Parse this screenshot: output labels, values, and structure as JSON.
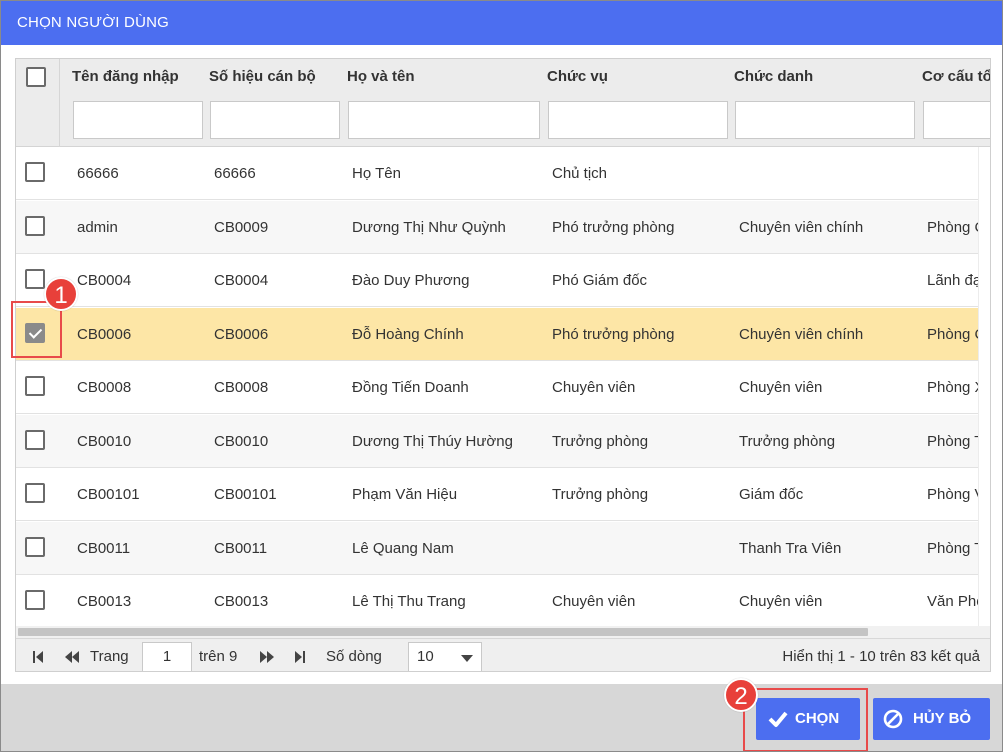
{
  "dialog": {
    "title": "CHỌN NGƯỜI DÙNG"
  },
  "columns": [
    "Tên đăng nhập",
    "Số hiệu cán bộ",
    "Họ và tên",
    "Chức vụ",
    "Chức danh",
    "Cơ cấu tổ"
  ],
  "rows": [
    {
      "username": "66666",
      "code": "66666",
      "fullname": "Họ Tên",
      "position": "Chủ tịch",
      "title": "",
      "org": "",
      "checked": false
    },
    {
      "username": "admin",
      "code": "CB0009",
      "fullname": "Dương Thị Như Quỳnh",
      "position": "Phó trưởng phòng",
      "title": "Chuyên viên chính",
      "org": "Phòng C",
      "checked": false
    },
    {
      "username": "CB0004",
      "code": "CB0004",
      "fullname": "Đào Duy Phương",
      "position": "Phó Giám đốc",
      "title": "",
      "org": "Lãnh đạ",
      "checked": false
    },
    {
      "username": "CB0006",
      "code": "CB0006",
      "fullname": "Đỗ Hoàng Chính",
      "position": "Phó trưởng phòng",
      "title": "Chuyên viên chính",
      "org": "Phòng C",
      "checked": true
    },
    {
      "username": "CB0008",
      "code": "CB0008",
      "fullname": "Đồng Tiến Doanh",
      "position": "Chuyên viên",
      "title": "Chuyên viên",
      "org": "Phòng X",
      "checked": false
    },
    {
      "username": "CB0010",
      "code": "CB0010",
      "fullname": "Dương Thị Thúy Hường",
      "position": "Trưởng phòng",
      "title": "Trưởng phòng",
      "org": "Phòng T",
      "checked": false
    },
    {
      "username": "CB00101",
      "code": "CB00101",
      "fullname": "Phạm Văn Hiệu",
      "position": "Trưởng phòng",
      "title": "Giám đốc",
      "org": "Phòng V",
      "checked": false
    },
    {
      "username": "CB0011",
      "code": "CB0011",
      "fullname": "Lê Quang Nam",
      "position": "",
      "title": "Thanh Tra Viên",
      "org": "Phòng T",
      "checked": false
    },
    {
      "username": "CB0013",
      "code": "CB0013",
      "fullname": "Lê Thị Thu Trang",
      "position": "Chuyên viên",
      "title": "Chuyên viên",
      "org": "Văn Phò",
      "checked": false
    }
  ],
  "pager": {
    "page_label": "Trang",
    "page_value": "1",
    "of_label": "trên 9",
    "rows_label": "Số dòng",
    "rows_value": "10",
    "summary": "Hiển thị 1 - 10 trên 83 kết quả"
  },
  "buttons": {
    "choose": "CHỌN",
    "cancel": "HỦY BỎ"
  },
  "callouts": {
    "one": "1",
    "two": "2"
  },
  "colors": {
    "accent": "#4c6ef0",
    "selected_row": "#fde6a6",
    "callout": "#e8403a"
  }
}
